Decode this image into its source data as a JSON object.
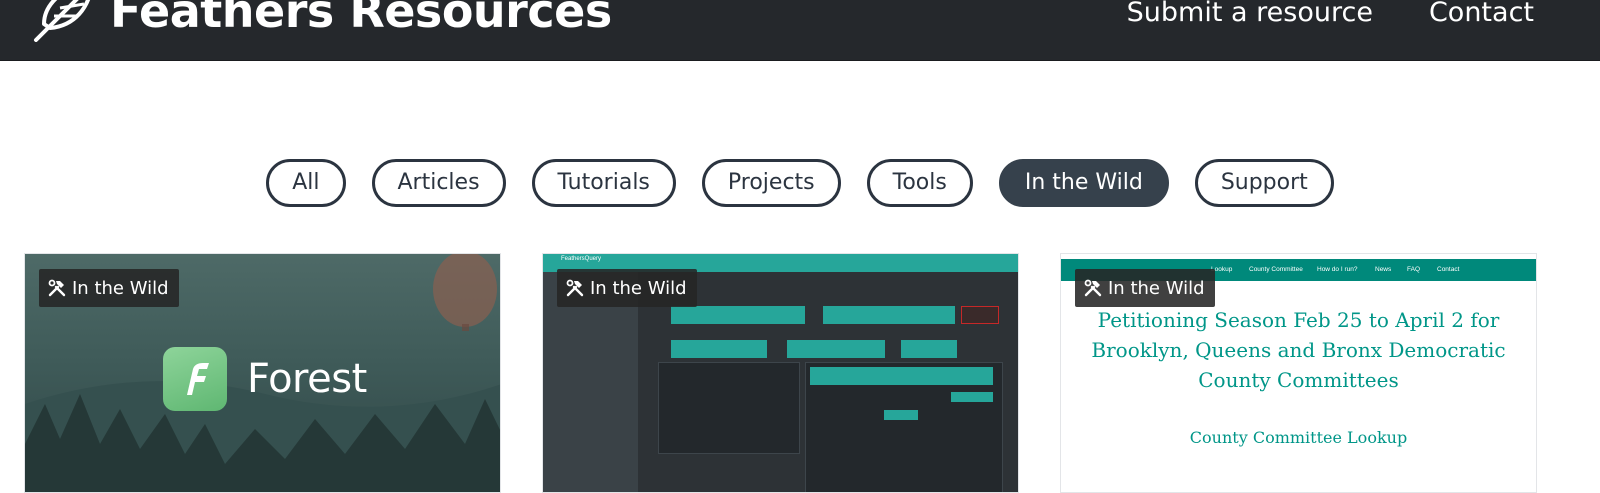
{
  "header": {
    "title": "Feathers Resources",
    "logo_icon": "feather-icon",
    "nav": [
      {
        "label": "Submit a resource"
      },
      {
        "label": "Contact"
      }
    ]
  },
  "filters": [
    {
      "label": "All",
      "active": false
    },
    {
      "label": "Articles",
      "active": false
    },
    {
      "label": "Tutorials",
      "active": false
    },
    {
      "label": "Projects",
      "active": false
    },
    {
      "label": "Tools",
      "active": false
    },
    {
      "label": "In the Wild",
      "active": true
    },
    {
      "label": "Support",
      "active": false
    }
  ],
  "cards": [
    {
      "tag": "In the Wild",
      "tag_icon": "tools-icon",
      "preview_text": "Forest"
    },
    {
      "tag": "In the Wild",
      "tag_icon": "tools-icon",
      "preview_text": "FeathersQuery"
    },
    {
      "tag": "In the Wild",
      "tag_icon": "tools-icon",
      "preview_nav": [
        "Lookup",
        "County Committee",
        "How do I run?",
        "News",
        "FAQ",
        "Contact"
      ],
      "preview_headline": "Petitioning Season Feb 25 to April 2 for Brooklyn, Queens and Bronx Democratic County Committees",
      "preview_subheading": "County Committee Lookup"
    }
  ],
  "colors": {
    "header_bg": "#25282c",
    "pill_border": "#2b3440",
    "pill_active_bg": "#36414c",
    "teal": "#26a69a",
    "cc_teal": "#009688"
  }
}
